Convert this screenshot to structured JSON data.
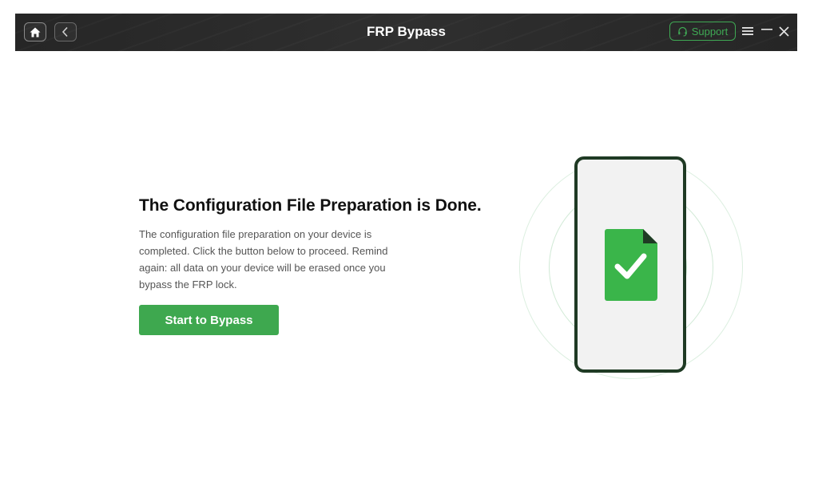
{
  "titlebar": {
    "title": "FRP Bypass",
    "support_label": "Support",
    "icons": {
      "home": "home-icon",
      "back": "chevron-left-icon",
      "support": "headset-icon",
      "menu": "hamburger-menu-icon",
      "minimize": "minimize-icon",
      "close": "close-icon"
    }
  },
  "main": {
    "heading": "The Configuration File Preparation is Done.",
    "description": "The configuration file preparation on your device is completed. Click the button below to proceed. Remind again: all data on your device will be erased once you bypass the FRP lock.",
    "button_label": "Start to Bypass"
  },
  "illustration": {
    "icons": {
      "phone": "phone-icon",
      "document": "document-check-icon"
    }
  },
  "colors": {
    "accent": "#3ea84f",
    "titlebar_bg": "#2b2b2b",
    "phone_border": "#1f3a24",
    "heading": "#111111",
    "body_text": "#555555"
  }
}
